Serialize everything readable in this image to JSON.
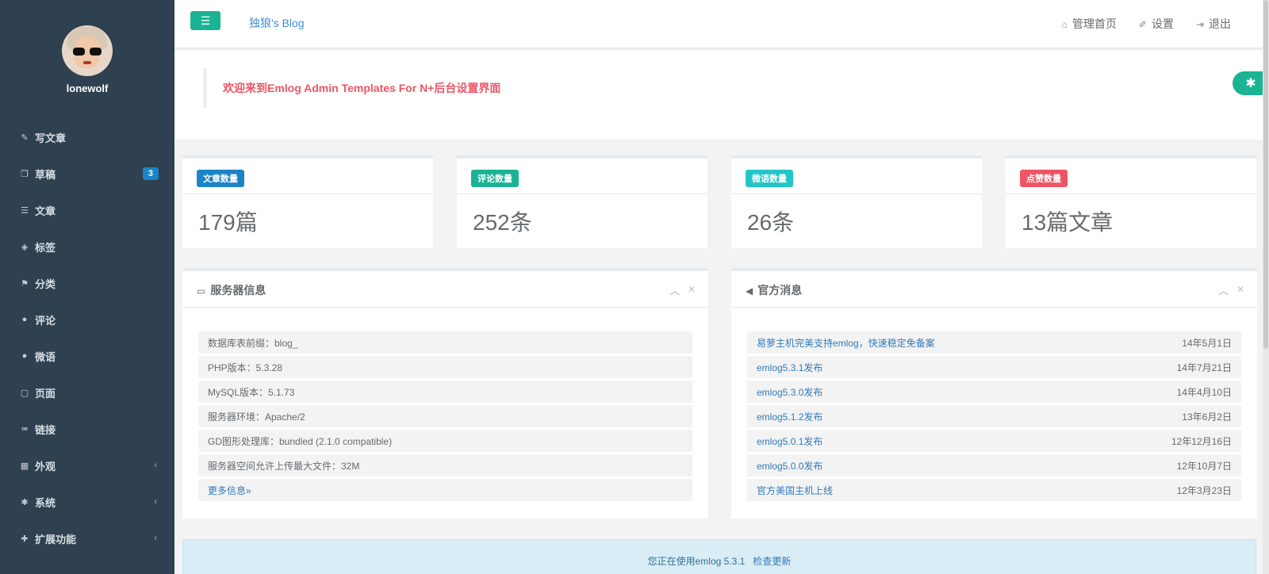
{
  "sidebar": {
    "username": "lonewolf",
    "items": [
      {
        "label": "写文章",
        "icon": "edit-icon",
        "glyph": "✎"
      },
      {
        "label": "草稿",
        "icon": "drafts-icon",
        "glyph": "❐",
        "badge": "3"
      },
      {
        "label": "文章",
        "icon": "list-icon",
        "glyph": "☰"
      },
      {
        "label": "标签",
        "icon": "tags-icon",
        "glyph": "◈"
      },
      {
        "label": "分类",
        "icon": "flag-icon",
        "glyph": "⚑"
      },
      {
        "label": "评论",
        "icon": "comments-icon",
        "glyph": "●"
      },
      {
        "label": "微语",
        "icon": "comment-icon",
        "glyph": "●"
      },
      {
        "label": "页面",
        "icon": "file-icon",
        "glyph": "▢"
      },
      {
        "label": "链接",
        "icon": "link-icon",
        "glyph": "∞"
      },
      {
        "label": "外观",
        "icon": "windows-icon",
        "glyph": "▦",
        "chevron": "‹"
      },
      {
        "label": "系统",
        "icon": "gear-icon",
        "glyph": "✱",
        "chevron": "‹"
      },
      {
        "label": "扩展功能",
        "icon": "puzzle-icon",
        "glyph": "✚",
        "chevron": "‹"
      }
    ]
  },
  "topbar": {
    "blog_title": "独狼's Blog",
    "links": [
      {
        "label": "管理首页",
        "icon": "home-icon",
        "glyph": "⌂"
      },
      {
        "label": "设置",
        "icon": "wrench-icon",
        "glyph": "✐"
      },
      {
        "label": "退出",
        "icon": "sign-out-icon",
        "glyph": "⇥"
      }
    ]
  },
  "welcome": {
    "message": "欢迎来到Emlog Admin Templates For N+后台设置界面"
  },
  "stats": [
    {
      "label": "文章数量",
      "value": "179篇",
      "color": "#1c84c6"
    },
    {
      "label": "评论数量",
      "value": "252条",
      "color": "#1ab394"
    },
    {
      "label": "微语数量",
      "value": "26条",
      "color": "#23c6c8"
    },
    {
      "label": "点赞数量",
      "value": "13篇文章",
      "color": "#ed5565"
    }
  ],
  "server_panel": {
    "title": "服务器信息",
    "rows": [
      "数据库表前缀：blog_",
      "PHP版本：5.3.28",
      "MySQL版本：5.1.73",
      "服务器环境：Apache/2",
      "GD图形处理库：bundled (2.1.0 compatible)",
      "服务器空间允许上传最大文件：32M"
    ],
    "more_link": "更多信息»"
  },
  "news_panel": {
    "title": "官方消息",
    "items": [
      {
        "title": "易萝主机完美支持emlog，快速稳定免备案",
        "date": "14年5月1日"
      },
      {
        "title": "emlog5.3.1发布",
        "date": "14年7月21日"
      },
      {
        "title": "emlog5.3.0发布",
        "date": "14年4月10日"
      },
      {
        "title": "emlog5.1.2发布",
        "date": "13年6月2日"
      },
      {
        "title": "emlog5.0.1发布",
        "date": "12年12月16日"
      },
      {
        "title": "emlog5.0.0发布",
        "date": "12年10月7日"
      },
      {
        "title": "官方美国主机上线",
        "date": "12年3月23日"
      }
    ]
  },
  "footer": {
    "version_text": "您正在使用emlog 5.3.1",
    "update_link": "检查更新"
  },
  "colors": {
    "sidebar_bg": "#2f4050",
    "accent": "#1ab394",
    "welcome_text": "#ed5565"
  }
}
